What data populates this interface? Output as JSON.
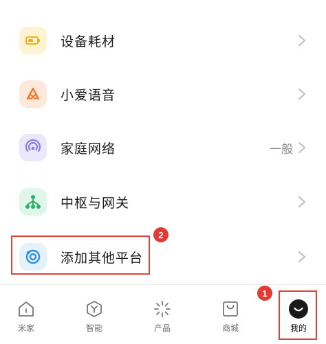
{
  "settings_list": {
    "items": [
      {
        "label": "设备耗材",
        "value": "",
        "icon": "battery-icon",
        "tile_color": "#fff3d4",
        "icon_color": "#f5b400"
      },
      {
        "label": "小爱语音",
        "value": "",
        "icon": "xiaoai-icon",
        "tile_color": "#fde9dc",
        "icon_color": "#ef7a2e"
      },
      {
        "label": "家庭网络",
        "value": "一般",
        "icon": "wifi-signal-icon",
        "tile_color": "#ece8fb",
        "icon_color": "#8d7ae0"
      },
      {
        "label": "中枢与网关",
        "value": "",
        "icon": "hub-icon",
        "tile_color": "#e0f6ea",
        "icon_color": "#28b266"
      },
      {
        "label": "添加其他平台",
        "value": "",
        "icon": "platform-icon",
        "tile_color": "#e3f2fd",
        "icon_color": "#2f8fe0"
      }
    ]
  },
  "annotations": {
    "badge_1": "1",
    "badge_2": "2",
    "accent_color": "#d9453d"
  },
  "tabbar": {
    "tabs": [
      {
        "label": "米家",
        "icon": "home-icon",
        "active": false
      },
      {
        "label": "智能",
        "icon": "smart-icon",
        "active": false
      },
      {
        "label": "产品",
        "icon": "product-icon",
        "active": false
      },
      {
        "label": "商城",
        "icon": "shop-icon",
        "active": false
      },
      {
        "label": "我的",
        "icon": "profile-icon",
        "active": true
      }
    ]
  }
}
